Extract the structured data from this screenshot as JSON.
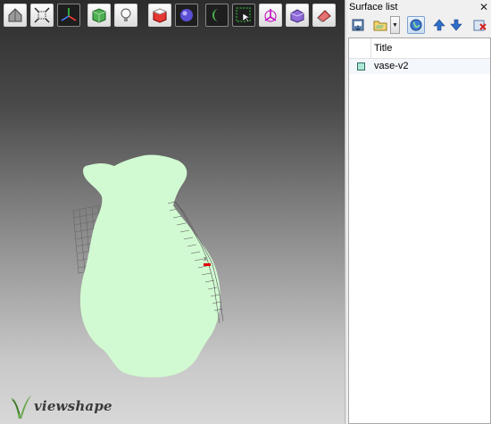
{
  "viewport": {
    "toolbar": [
      {
        "name": "home-view-icon",
        "style": "light"
      },
      {
        "name": "fit-view-icon",
        "style": "light"
      },
      {
        "name": "axes-icon",
        "style": "dark"
      },
      {
        "name": "solid-cube-icon",
        "style": "light"
      },
      {
        "name": "light-bulb-icon",
        "style": "light"
      },
      {
        "name": "box-shading-icon",
        "style": "light"
      },
      {
        "name": "sphere-icon",
        "style": "dark"
      },
      {
        "name": "moon-icon",
        "style": "dark"
      },
      {
        "name": "select-region-icon",
        "style": "dark"
      },
      {
        "name": "rotate-axis-icon",
        "style": "light"
      },
      {
        "name": "purple-cube-icon",
        "style": "light"
      },
      {
        "name": "eraser-icon",
        "style": "light"
      }
    ],
    "surface_color": "#d2fad2",
    "mesh_color": "#666666",
    "logo_text": "viewshape"
  },
  "panel": {
    "title": "Surface list",
    "close_label": "✕",
    "column_title": "Title",
    "surfaces": [
      {
        "title": "vase-v2",
        "swatch": "#aee8d6"
      }
    ]
  }
}
